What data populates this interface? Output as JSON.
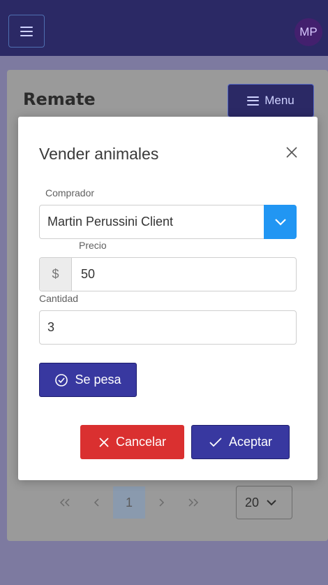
{
  "header": {
    "menu_icon": "hamburger-icon",
    "avatar_initials": "MP",
    "colors": {
      "bar": "#2b2965",
      "avatar": "#43206e"
    }
  },
  "page": {
    "title": "Remate",
    "menu_button_label": "Menu",
    "pagination": {
      "first": "<<",
      "prev": "<",
      "current": "1",
      "next": ">",
      "last": ">>",
      "page_size": "20"
    }
  },
  "modal": {
    "title": "Vender animales",
    "close_icon": "close-icon",
    "comprador": {
      "label": "Comprador",
      "value": "Martin Perussini Client"
    },
    "precio": {
      "label": "Precio",
      "prefix": "$",
      "value": "50"
    },
    "cantidad": {
      "label": "Cantidad",
      "value": "3"
    },
    "se_pesa_label": "Se pesa",
    "cancel_label": "Cancelar",
    "accept_label": "Aceptar",
    "colors": {
      "primary": "#3838a0",
      "danger": "#da3030",
      "select_button": "#2196f3"
    }
  }
}
